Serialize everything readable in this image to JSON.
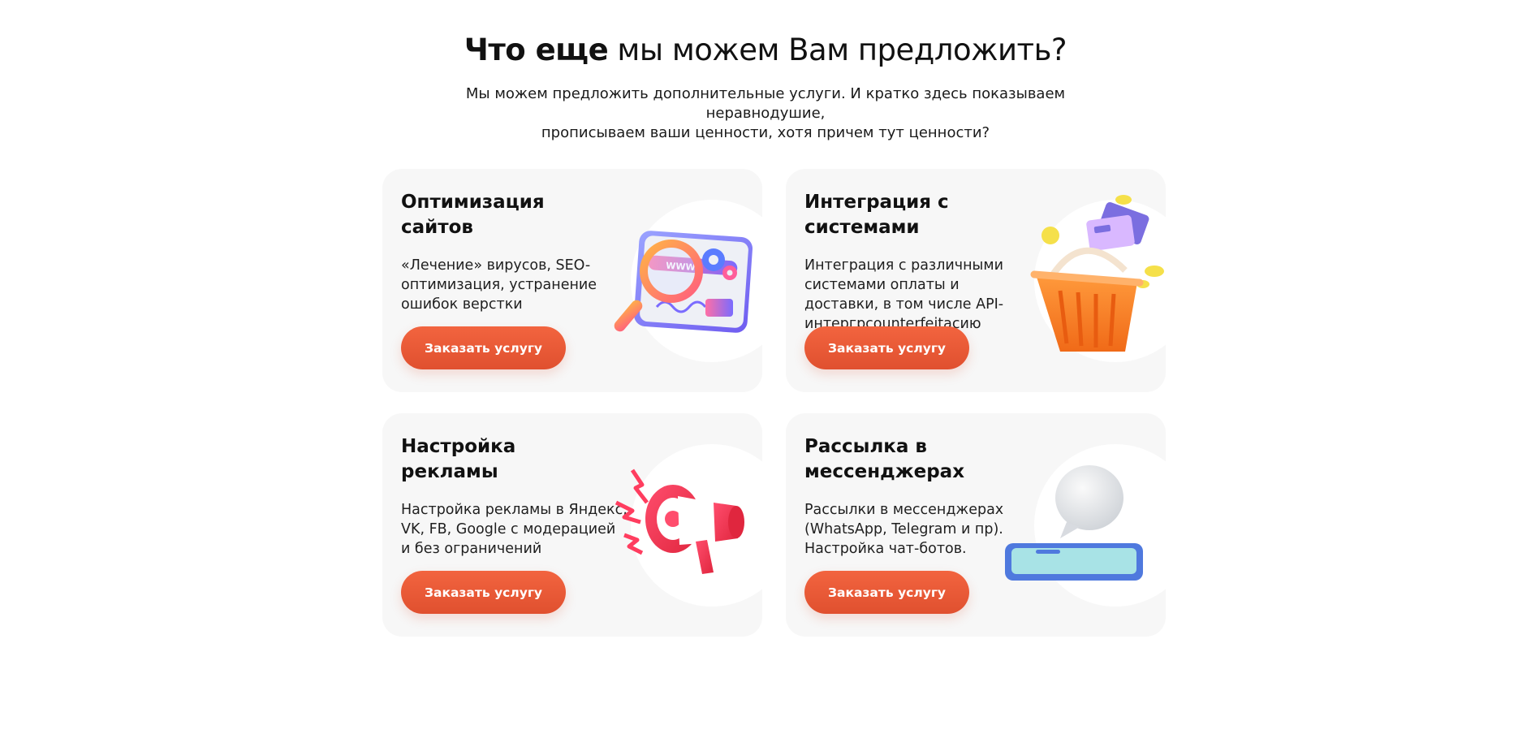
{
  "section": {
    "heading_strong": "Что еще",
    "heading_rest": " мы можем Вам предложить?",
    "subtitle_line1": "Мы можем предложить дополнительные услуги. И кратко здесь показываем неравнодушие,",
    "subtitle_line2": "прописываем ваши ценности, хотя причем тут ценности?"
  },
  "services": [
    {
      "title": "Оптимизация сайтов",
      "description": "«Лечение» вирусов, SEO-оптимизация, устранение ошибок верстки",
      "button": "Заказать услугу",
      "icon": "magnifier-browser-icon"
    },
    {
      "title": "Интеграция с системами",
      "description": "Интеграция с различными системами оплаты и доставки, в том числе API-интергрcounterfeitacию",
      "button": "Заказать услугу",
      "icon": "shopping-basket-icon"
    },
    {
      "title": "Настройка рекламы",
      "description": "Настройка рекламы в Яндекс, VK, FB, Google с модерацией и без ограничений",
      "button": "Заказать услугу",
      "icon": "megaphone-icon"
    },
    {
      "title": "Рассылка в мессенджерах",
      "description": "Рассылки в мессенджерах (WhatsApp, Telegram и пр). Настройка чат-ботов.",
      "button": "Заказать услугу",
      "icon": "phone-chat-bubble-icon"
    }
  ],
  "colors": {
    "accent": "#e85a35",
    "card_bg": "#f7f7f7"
  }
}
